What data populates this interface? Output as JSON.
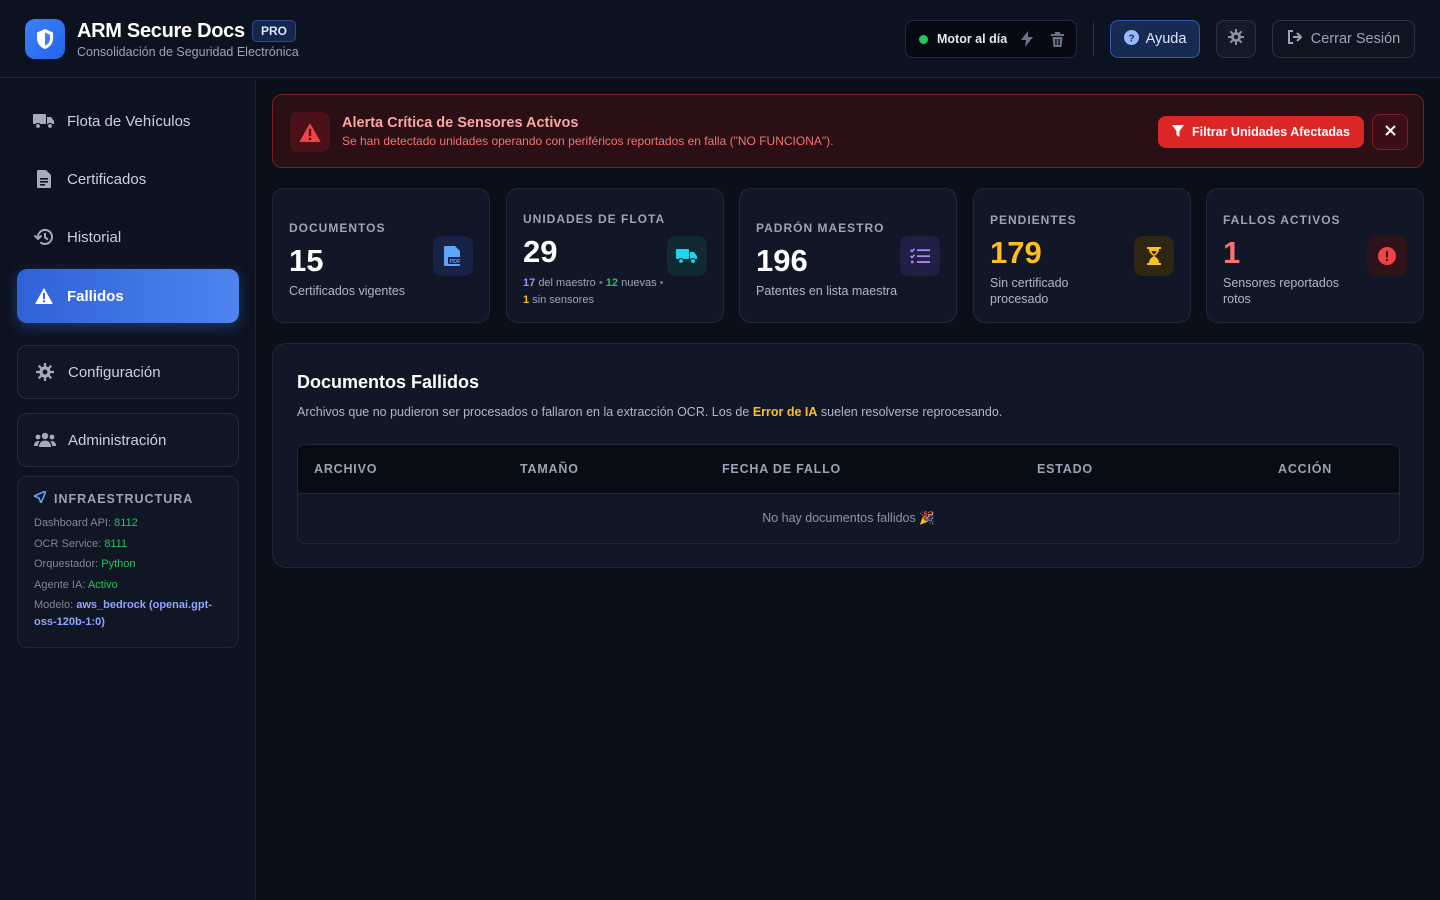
{
  "header": {
    "title": "ARM Secure Docs",
    "badge": "PRO",
    "subtitle": "Consolidación de Seguridad Electrónica",
    "engine_status": "Motor al día",
    "help_label": "Ayuda",
    "logout_label": "Cerrar Sesión"
  },
  "sidebar": {
    "items": [
      {
        "label": "Flota de Vehículos",
        "icon": "truck-icon"
      },
      {
        "label": "Certificados",
        "icon": "file-icon"
      },
      {
        "label": "Historial",
        "icon": "history-icon"
      },
      {
        "label": "Fallidos",
        "icon": "warning-icon"
      },
      {
        "label": "Configuración",
        "icon": "gear-icon"
      },
      {
        "label": "Administración",
        "icon": "users-icon"
      }
    ],
    "infra": {
      "title": "INFRAESTRUCTURA",
      "rows": [
        {
          "key": "Dashboard API:",
          "value": "8112"
        },
        {
          "key": "OCR Service:",
          "value": "8111"
        },
        {
          "key": "Orquestador:",
          "value": "Python"
        },
        {
          "key": "Agente IA:",
          "value": "Activo"
        },
        {
          "key": "Modelo:",
          "value": "aws_bedrock (openai.gpt-oss-120b-1:0)"
        }
      ]
    }
  },
  "alert": {
    "title": "Alerta Crítica de Sensores Activos",
    "text": "Se han detectado unidades operando con periféricos reportados en falla (\"NO FUNCIONA\").",
    "filter_label": "Filtrar Unidades Afectadas"
  },
  "stats": {
    "documentos": {
      "label": "DOCUMENTOS",
      "value": "15",
      "sub": "Certificados vigentes"
    },
    "flota": {
      "label": "UNIDADES DE FLOTA",
      "value": "29",
      "meta1_num": "17",
      "meta1_text": "del maestro",
      "meta2_num": "12",
      "meta2_text": "nuevas",
      "meta3_num": "1",
      "meta3_text": "sin sensores"
    },
    "padron": {
      "label": "PADRÓN MAESTRO",
      "value": "196",
      "sub": "Patentes en lista maestra"
    },
    "pendientes": {
      "label": "PENDIENTES",
      "value": "179",
      "sub": "Sin certificado procesado"
    },
    "fallos": {
      "label": "FALLOS ACTIVOS",
      "value": "1",
      "sub": "Sensores reportados rotos"
    }
  },
  "panel": {
    "title": "Documentos Fallidos",
    "desc_before": "Archivos que no pudieron ser procesados o fallaron en la extracción OCR. Los de ",
    "desc_highlight": "Error de IA",
    "desc_after": " suelen resolverse reprocesando.",
    "columns": [
      "ARCHIVO",
      "TAMAÑO",
      "FECHA DE FALLO",
      "ESTADO",
      "ACCIÓN"
    ],
    "empty_message": "No hay documentos fallidos 🎉"
  },
  "colors": {
    "accent": "#3b82f6",
    "danger": "#dc2626",
    "warning": "#fbbf24",
    "success": "#22c55e"
  }
}
